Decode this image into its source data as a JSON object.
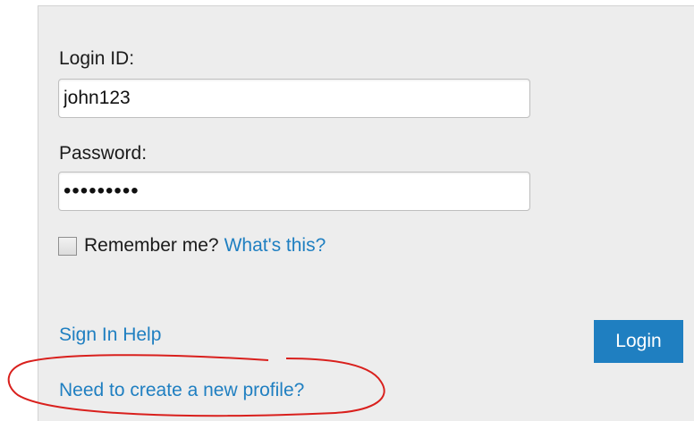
{
  "form": {
    "login_id_label": "Login ID:",
    "login_id_value": "john123",
    "password_label": "Password:",
    "password_value": "•••••••••",
    "remember_label": "Remember me?",
    "remember_checked": false,
    "whats_this_link": "What's this?",
    "sign_in_help_link": "Sign In Help",
    "new_profile_link": "Need to create a new profile?",
    "login_button": "Login"
  },
  "colors": {
    "panel_background": "#ededed",
    "link": "#1f7fc1",
    "button": "#1f7fc1",
    "annotation": "#d9201d"
  }
}
